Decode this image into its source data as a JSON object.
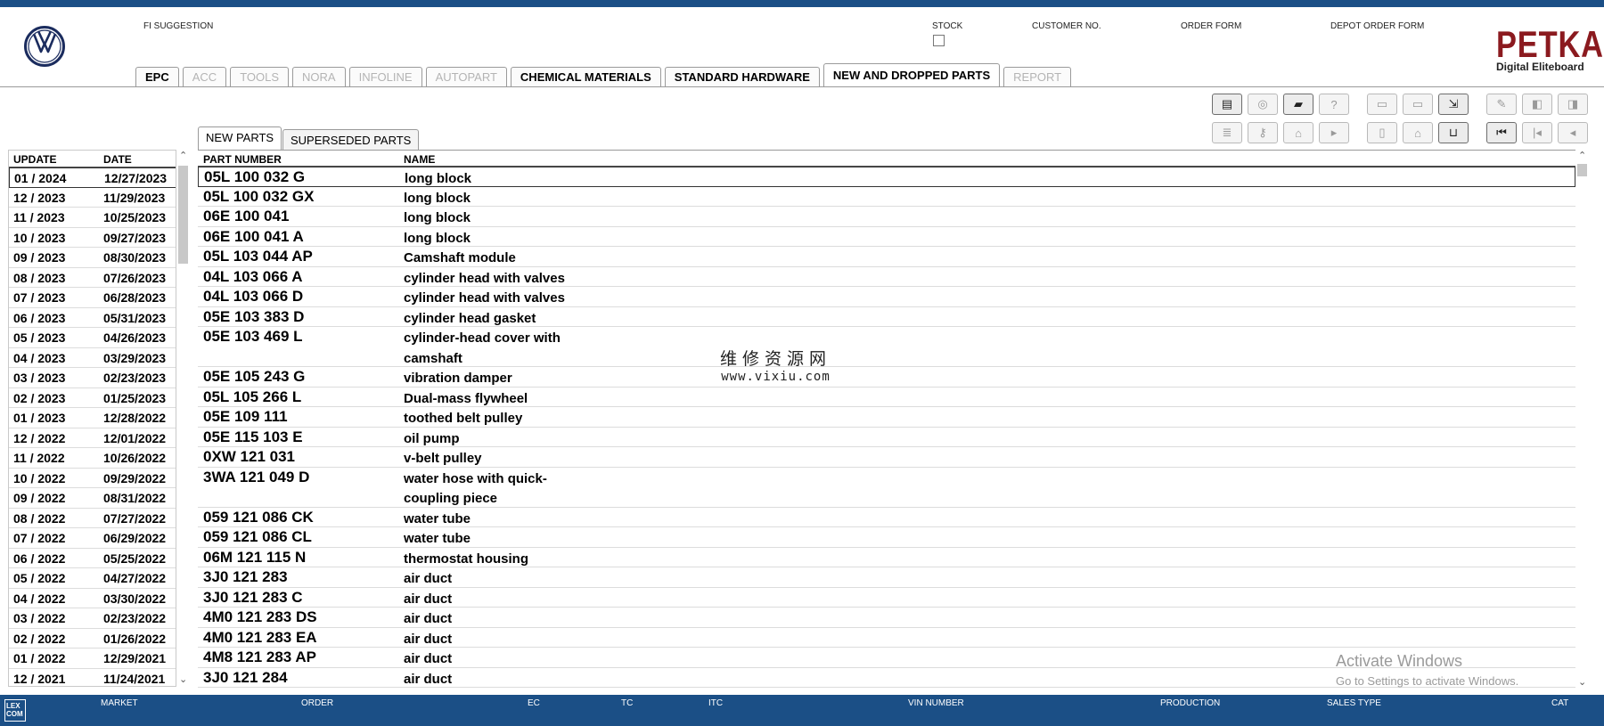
{
  "header": {
    "labels": {
      "fi_suggestion": "FI SUGGESTION",
      "stock": "STOCK",
      "customer_no": "CUSTOMER NO.",
      "order_form": "ORDER FORM",
      "depot_order_form": "DEPOT ORDER FORM"
    },
    "brand": {
      "name": "PETKA",
      "subtitle": "Digital Eliteboard"
    },
    "tabs": [
      {
        "label": "EPC",
        "state": "enabled"
      },
      {
        "label": "ACC",
        "state": "disabled"
      },
      {
        "label": "TOOLS",
        "state": "disabled"
      },
      {
        "label": "NORA",
        "state": "disabled"
      },
      {
        "label": "INFOLINE",
        "state": "disabled"
      },
      {
        "label": "AUTOPART",
        "state": "disabled"
      },
      {
        "label": "CHEMICAL MATERIALS",
        "state": "enabled"
      },
      {
        "label": "STANDARD HARDWARE",
        "state": "enabled"
      },
      {
        "label": "NEW AND DROPPED PARTS",
        "state": "active"
      },
      {
        "label": "REPORT",
        "state": "disabled"
      }
    ]
  },
  "toolbar": {
    "row1": [
      {
        "icon": "print-icon",
        "enabled": true
      },
      {
        "icon": "disc-icon",
        "enabled": false
      },
      {
        "icon": "car-icon",
        "enabled": true
      },
      {
        "icon": "help-icon",
        "enabled": false
      },
      {
        "icon": "elsa-icon",
        "enabled": false
      },
      {
        "icon": "depot-icon",
        "enabled": false
      },
      {
        "icon": "cart-arrow-icon",
        "enabled": true
      },
      {
        "icon": "pin-icon",
        "enabled": false
      },
      {
        "icon": "page-left-icon",
        "enabled": false
      },
      {
        "icon": "page-right-icon",
        "enabled": false
      }
    ],
    "row2": [
      {
        "icon": "list-icon",
        "enabled": false
      },
      {
        "icon": "key-icon",
        "enabled": false
      },
      {
        "icon": "vehicle-icon",
        "enabled": false
      },
      {
        "icon": "play-minus-icon",
        "enabled": false
      },
      {
        "icon": "device-icon",
        "enabled": false
      },
      {
        "icon": "house-icon",
        "enabled": false
      },
      {
        "icon": "cart-icon",
        "enabled": true
      },
      {
        "icon": "first-icon",
        "enabled": true
      },
      {
        "icon": "previous-icon",
        "enabled": false
      },
      {
        "icon": "back-icon",
        "enabled": false
      }
    ]
  },
  "left_panel": {
    "headers": {
      "update": "UPDATE",
      "date": "DATE"
    },
    "rows": [
      {
        "update": "01 / 2024",
        "date": "12/27/2023"
      },
      {
        "update": "12 / 2023",
        "date": "11/29/2023"
      },
      {
        "update": "11 / 2023",
        "date": "10/25/2023"
      },
      {
        "update": "10 / 2023",
        "date": "09/27/2023"
      },
      {
        "update": "09 / 2023",
        "date": "08/30/2023"
      },
      {
        "update": "08 / 2023",
        "date": "07/26/2023"
      },
      {
        "update": "07 / 2023",
        "date": "06/28/2023"
      },
      {
        "update": "06 / 2023",
        "date": "05/31/2023"
      },
      {
        "update": "05 / 2023",
        "date": "04/26/2023"
      },
      {
        "update": "04 / 2023",
        "date": "03/29/2023"
      },
      {
        "update": "03 / 2023",
        "date": "02/23/2023"
      },
      {
        "update": "02 / 2023",
        "date": "01/25/2023"
      },
      {
        "update": "01 / 2023",
        "date": "12/28/2022"
      },
      {
        "update": "12 / 2022",
        "date": "12/01/2022"
      },
      {
        "update": "11 / 2022",
        "date": "10/26/2022"
      },
      {
        "update": "10 / 2022",
        "date": "09/29/2022"
      },
      {
        "update": "09 / 2022",
        "date": "08/31/2022"
      },
      {
        "update": "08 / 2022",
        "date": "07/27/2022"
      },
      {
        "update": "07 / 2022",
        "date": "06/29/2022"
      },
      {
        "update": "06 / 2022",
        "date": "05/25/2022"
      },
      {
        "update": "05 / 2022",
        "date": "04/27/2022"
      },
      {
        "update": "04 / 2022",
        "date": "03/30/2022"
      },
      {
        "update": "03 / 2022",
        "date": "02/23/2022"
      },
      {
        "update": "02 / 2022",
        "date": "01/26/2022"
      },
      {
        "update": "01 / 2022",
        "date": "12/29/2021"
      },
      {
        "update": "12 / 2021",
        "date": "11/24/2021"
      }
    ]
  },
  "subtabs": {
    "new_parts": "NEW PARTS",
    "superseded_parts": "SUPERSEDED PARTS"
  },
  "main_table": {
    "headers": {
      "part_number": "PART NUMBER",
      "name": "NAME"
    },
    "rows": [
      {
        "part": "05L 100 032 G",
        "name": "long block"
      },
      {
        "part": "05L 100 032 GX",
        "name": "long block"
      },
      {
        "part": "06E 100 041",
        "name": "long block"
      },
      {
        "part": "06E 100 041 A",
        "name": "long block"
      },
      {
        "part": "05L 103 044 AP",
        "name": "Camshaft module"
      },
      {
        "part": "04L 103 066 A",
        "name": "cylinder head with valves"
      },
      {
        "part": "04L 103 066 D",
        "name": "cylinder head with valves"
      },
      {
        "part": "05E 103 383 D",
        "name": "cylinder head gasket"
      },
      {
        "part": "05E 103 469 L",
        "name": "cylinder-head cover with camshaft"
      },
      {
        "part": "05E 105 243 G",
        "name": "vibration damper"
      },
      {
        "part": "05L 105 266 L",
        "name": "Dual-mass flywheel"
      },
      {
        "part": "05E 109 111",
        "name": "toothed belt pulley"
      },
      {
        "part": "05E 115 103 E",
        "name": "oil pump"
      },
      {
        "part": "0XW 121 031",
        "name": "v-belt pulley"
      },
      {
        "part": "3WA 121 049 D",
        "name": "water hose with quick-coupling piece"
      },
      {
        "part": "059 121 086 CK",
        "name": "water tube"
      },
      {
        "part": "059 121 086 CL",
        "name": "water tube"
      },
      {
        "part": "06M 121 115 N",
        "name": "thermostat housing"
      },
      {
        "part": "3J0 121 283",
        "name": "air duct"
      },
      {
        "part": "3J0 121 283 C",
        "name": "air duct"
      },
      {
        "part": "4M0 121 283 DS",
        "name": "air duct"
      },
      {
        "part": "4M0 121 283 EA",
        "name": "air duct"
      },
      {
        "part": "4M8 121 283 AP",
        "name": "air duct"
      },
      {
        "part": "3J0 121 284",
        "name": "air duct"
      }
    ]
  },
  "watermark": {
    "line1": "维修资源网",
    "line2": "www.vixiu.com"
  },
  "activation_notice": {
    "title": "Activate Windows",
    "subtitle": "Go to Settings to activate Windows."
  },
  "footer": {
    "logo_text": "LEX COM",
    "labels": {
      "market": "MARKET",
      "order": "ORDER",
      "ec": "EC",
      "tc": "TC",
      "itc": "ITC",
      "vin": "VIN NUMBER",
      "production": "PRODUCTION",
      "sales_type": "SALES TYPE",
      "cat": "CAT"
    }
  },
  "colors": {
    "header_blue": "#1b4f86",
    "brand_red": "#8b1a1f",
    "disabled_text": "#b4b4b4"
  }
}
